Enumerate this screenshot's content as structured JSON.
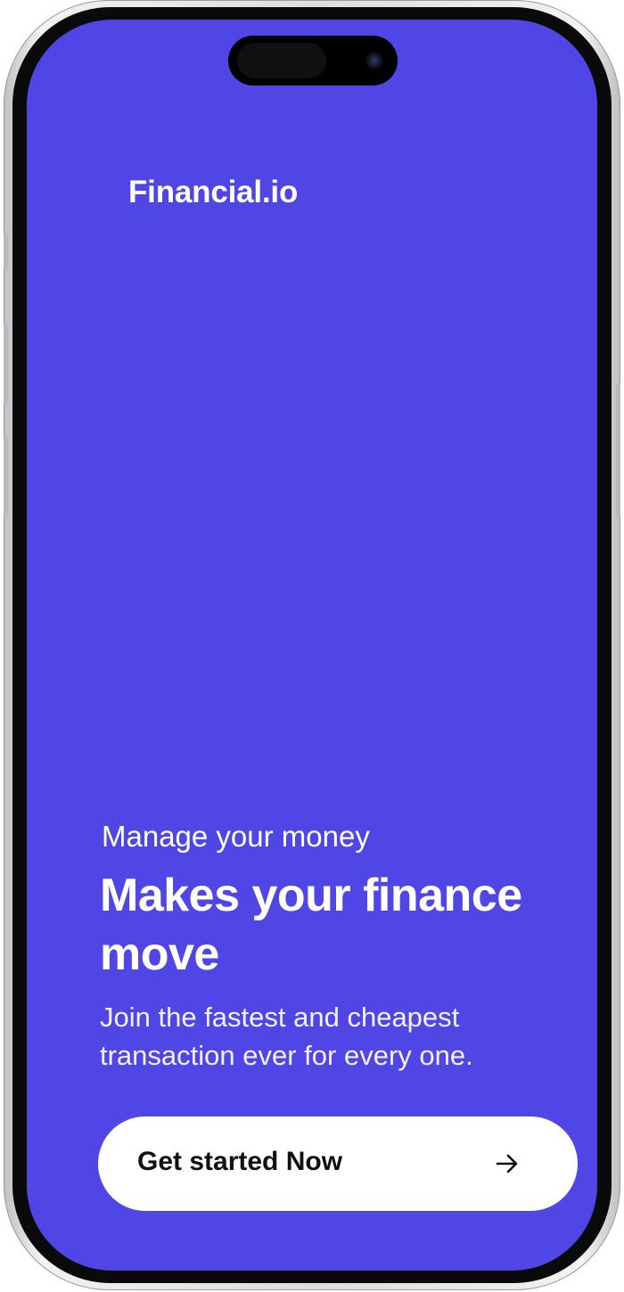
{
  "app": {
    "brand_name": "Financial.io",
    "accent_color": "#4f46e5",
    "button_color": "#ffffff"
  },
  "hero": {
    "eyebrow": "Manage your money",
    "headline": "Makes your finance move",
    "subtext": "Join the fastest and cheapest transaction ever for every one."
  },
  "cta": {
    "label": "Get started Now",
    "icon": "arrow-right-icon"
  }
}
